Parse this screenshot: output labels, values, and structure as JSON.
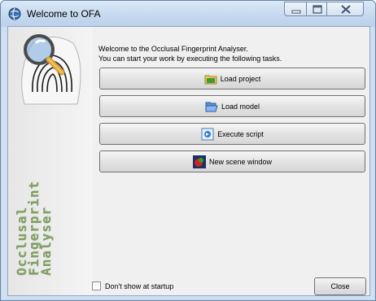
{
  "window": {
    "title": "Welcome to OFA",
    "icon": "ofa-globe-icon"
  },
  "controls": {
    "minimize_icon": "minimize-icon",
    "maximize_icon": "maximize-icon",
    "close_icon": "close-icon"
  },
  "banner": {
    "logo": "magnifier-fingerprint-logo",
    "brand_lines": [
      "Occlusal",
      "Fingerprint",
      "Analyser"
    ]
  },
  "intro": {
    "line1": "Welcome to the Occlusal Fingerprint Analyser.",
    "line2": "You can start your work by executing the following tasks."
  },
  "actions": [
    {
      "label": "Load project",
      "icon": "folder-icon"
    },
    {
      "label": "Load model",
      "icon": "open-folder-icon"
    },
    {
      "label": "Execute script",
      "icon": "script-icon"
    },
    {
      "label": "New scene window",
      "icon": "scene-icon"
    }
  ],
  "startup": {
    "label": "Don't show at startup",
    "checked": false
  },
  "close_label": "Close",
  "colors": {
    "brand_green": "#6e8f4e",
    "title_bar": "#c4d8ee"
  }
}
